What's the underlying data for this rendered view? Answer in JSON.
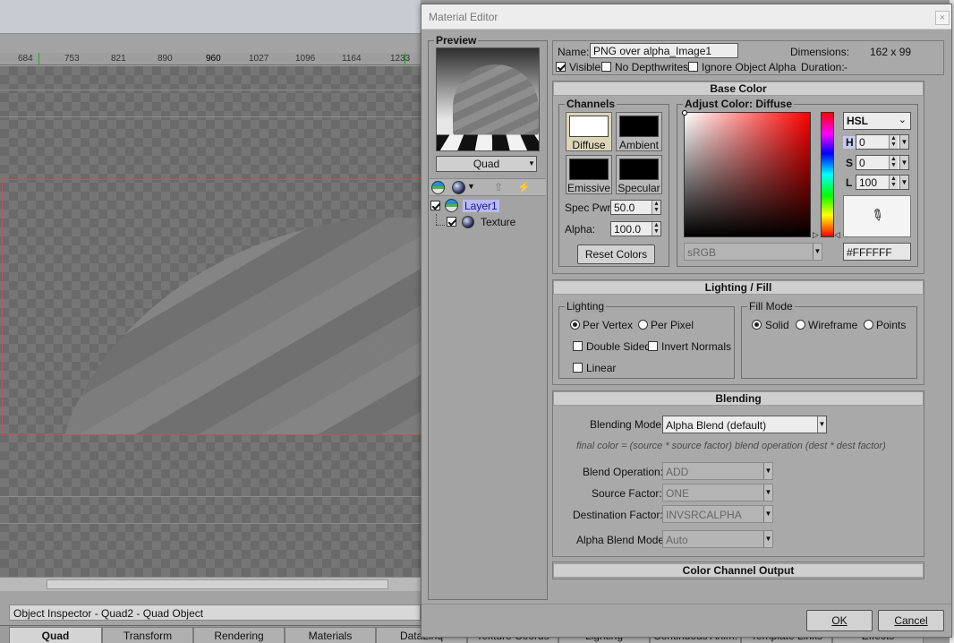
{
  "background": {
    "ruler_ticks": [
      "684",
      "753",
      "821",
      "890",
      "960",
      "1027",
      "1096",
      "1164",
      "1233"
    ],
    "inspector_title": "Object Inspector - Quad2 - Quad Object",
    "bottom_tabs": [
      "Quad",
      "Transform",
      "Rendering",
      "Materials",
      "DataLinq",
      "Texture Coords",
      "Lighting",
      "Continuous Anim.",
      "Template Links",
      "Effects"
    ],
    "active_tab": "Quad"
  },
  "dialog": {
    "title": "Material Editor",
    "close_glyph": "×",
    "ok_label": "OK",
    "cancel_label": "Cancel"
  },
  "preview": {
    "label": "Preview",
    "shape_value": "Quad",
    "layers": [
      {
        "name": "Layer1",
        "checked": true
      },
      {
        "name": "Texture",
        "checked": true
      }
    ]
  },
  "header": {
    "name_label": "Name:",
    "name_value": "PNG over alpha_Image1",
    "dimensions_label": "Dimensions:",
    "dimensions_value": "162 x 99",
    "visible_label": "Visible",
    "visible_checked": true,
    "no_depthwrites_label": "No Depthwrites",
    "ignore_alpha_label": "Ignore Object Alpha",
    "duration_label": "Duration:",
    "duration_value": "-"
  },
  "base_color": {
    "title": "Base Color",
    "channels_label": "Channels",
    "channels": [
      {
        "name": "Diffuse",
        "color": "#ffffff",
        "selected": true
      },
      {
        "name": "Ambient",
        "color": "#000000",
        "selected": false
      },
      {
        "name": "Emissive",
        "color": "#000000",
        "selected": false
      },
      {
        "name": "Specular",
        "color": "#000000",
        "selected": false
      }
    ],
    "spec_pwr_label": "Spec Pwr:",
    "spec_pwr_value": "50.0",
    "alpha_label": "Alpha:",
    "alpha_value": "100.0",
    "reset_label": "Reset Colors",
    "adjust_label": "Adjust Color: Diffuse",
    "color_space": "sRGB",
    "model": "HSL",
    "h_label": "H",
    "h_value": "0",
    "s_label": "S",
    "s_value": "0",
    "l_label": "L",
    "l_value": "100",
    "hex_value": "#FFFFFF"
  },
  "lighting_fill": {
    "title": "Lighting / Fill",
    "lighting_label": "Lighting",
    "per_vertex": "Per Vertex",
    "per_pixel": "Per Pixel",
    "double_sided": "Double Sided",
    "invert_normals": "Invert Normals",
    "linear": "Linear",
    "fill_mode_label": "Fill Mode",
    "solid": "Solid",
    "wireframe": "Wireframe",
    "points": "Points"
  },
  "blending": {
    "title": "Blending",
    "mode_label": "Blending Mode:",
    "mode_value": "Alpha Blend (default)",
    "formula": "final color = (source * source factor) blend operation (dest * dest factor)",
    "operation_label": "Blend Operation:",
    "operation_value": "ADD",
    "source_label": "Source Factor:",
    "source_value": "ONE",
    "dest_label": "Destination Factor:",
    "dest_value": "INVSRCALPHA",
    "alpha_mode_label": "Alpha Blend Mode:",
    "alpha_mode_value": "Auto"
  },
  "color_output": {
    "title": "Color Channel Output"
  }
}
